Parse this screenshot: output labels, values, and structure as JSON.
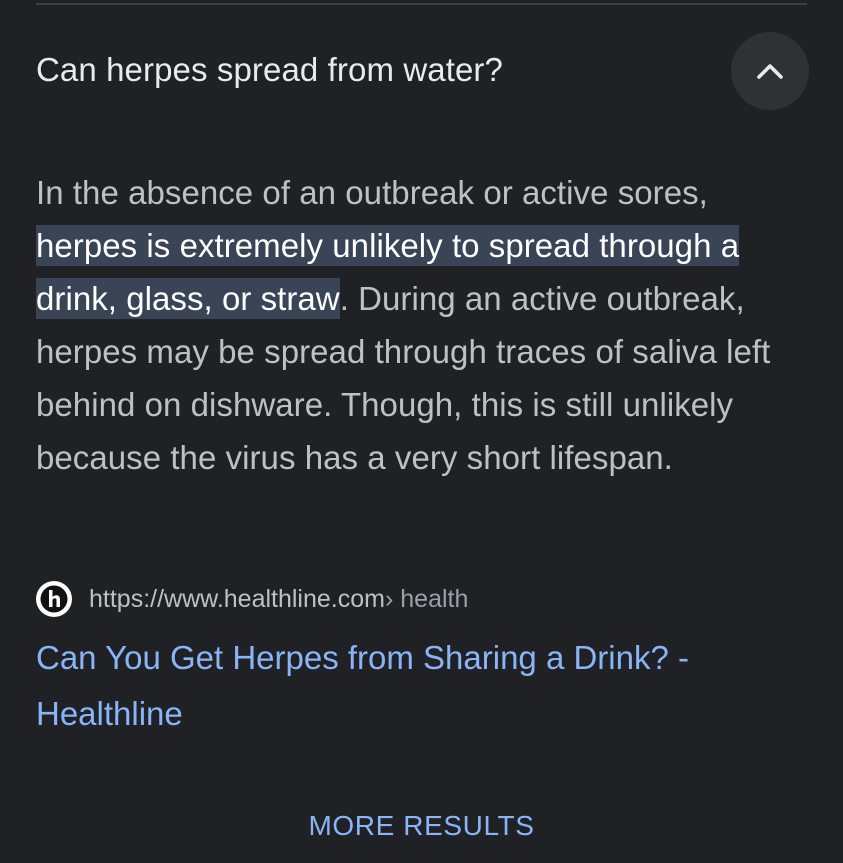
{
  "faq": {
    "question": "Can herpes spread from water?",
    "collapse_icon": "chevron-up-icon",
    "answer": {
      "before": "In the absence of an outbreak or active sores, ",
      "highlight": "herpes is extremely unlikely to spread through a drink, glass, or straw",
      "after": ". During an active outbreak, herpes may be spread through traces of saliva left behind on dishware. Though, this is still unlikely because the virus has a very short lifespan."
    },
    "source": {
      "favicon": "healthline-logo-icon",
      "url": "https://www.healthline.com",
      "path": " › health"
    },
    "link_title": "Can You Get Herpes from Sharing a Drink? - Healthline"
  },
  "footer": {
    "more_results_label": "MORE RESULTS"
  },
  "colors": {
    "background": "#202124",
    "question_text": "#e8eaed",
    "body_text": "#bdc1c6",
    "highlight_bg": "#394457",
    "link": "#8ab4f8",
    "button_bg": "#303134"
  }
}
